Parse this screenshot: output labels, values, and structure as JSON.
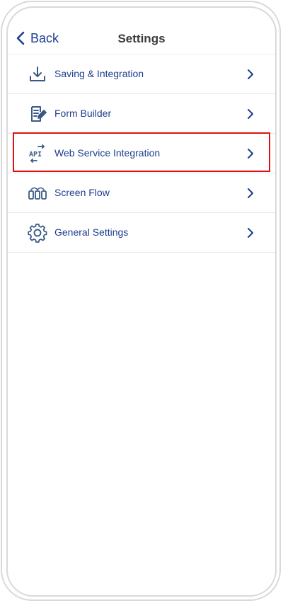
{
  "header": {
    "back_label": "Back",
    "title": "Settings"
  },
  "menu": {
    "items": [
      {
        "label": "Saving & Integration",
        "icon": "download-icon"
      },
      {
        "label": "Form Builder",
        "icon": "form-edit-icon"
      },
      {
        "label": "Web Service Integration",
        "icon": "api-icon",
        "highlighted": true
      },
      {
        "label": "Screen Flow",
        "icon": "screen-flow-icon"
      },
      {
        "label": "General Settings",
        "icon": "gear-icon"
      }
    ]
  },
  "colors": {
    "accent": "#1e3d8f",
    "icon": "#3a5a86",
    "highlight": "#e01010",
    "title": "#3a3a3a"
  }
}
